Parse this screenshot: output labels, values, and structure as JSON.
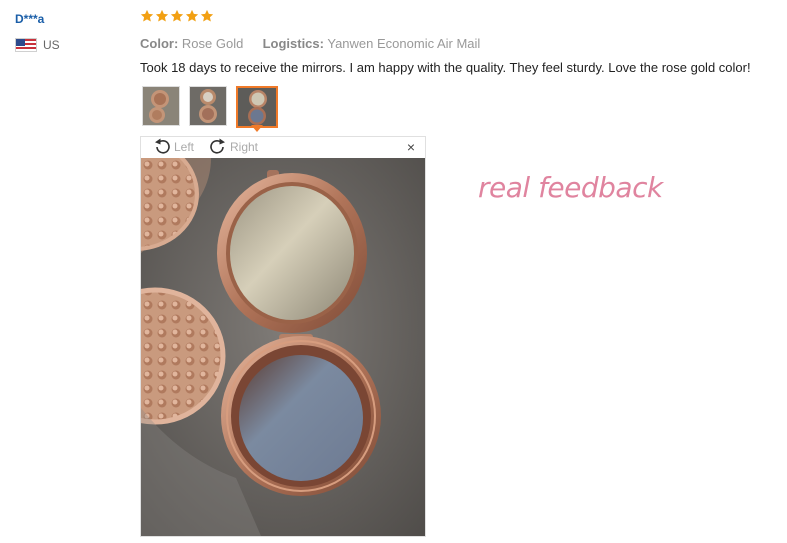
{
  "reviewer": {
    "name": "D***a",
    "country": "US",
    "flag_icon": "us-flag-icon"
  },
  "rating": {
    "stars": 5,
    "max": 5,
    "color": "#f2a013"
  },
  "details": {
    "color_label": "Color:",
    "color_value": "Rose Gold",
    "logistics_label": "Logistics:",
    "logistics_value": "Yanwen Economic Air Mail"
  },
  "review_text": "Took 18 days to receive the mirrors. I am happy with the quality. They feel sturdy. Love the rose gold color!",
  "thumbnails": {
    "count": 3,
    "selected_index": 2,
    "accent": "#f07a29"
  },
  "viewer": {
    "rotate_left_label": "Left",
    "rotate_right_label": "Right",
    "close_glyph": "×"
  },
  "overlay_text": "real feedback",
  "colors": {
    "username": "#1a5ea8",
    "overlay": "#e0849f"
  }
}
